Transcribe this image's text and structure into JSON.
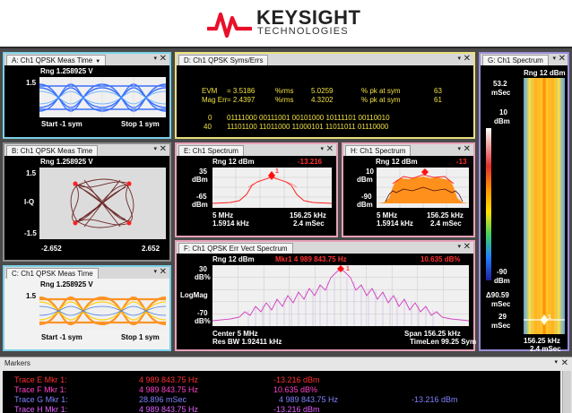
{
  "brand": {
    "name": "KEYSIGHT",
    "sub": "TECHNOLOGIES",
    "color": "#e8102b"
  },
  "windows": {
    "a": {
      "title": "A: Ch1 QPSK Meas Time",
      "rng": "Rng 1.258925  V",
      "ytop": "1.5",
      "start": "Start -1  sym",
      "stop": "Stop 1  sym"
    },
    "b": {
      "title": "B: Ch1 QPSK Meas Time",
      "rng": "Rng 1.258925  V",
      "ytop": "1.5",
      "ymid": "I-Q",
      "ybot": "-1.5",
      "xleft": "-2.652",
      "xright": "2.652"
    },
    "c": {
      "title": "C: Ch1 QPSK Meas Time",
      "rng": "Rng 1.258925  V",
      "ytop": "1.5",
      "start": "Start -1  sym",
      "stop": "Stop 1  sym"
    },
    "d": {
      "title": "D: Ch1 QPSK Syms/Errs",
      "evm_label": "EVM",
      "evm_value": "= 3.5186",
      "evm_unit": "%rms",
      "evm_pk": "5.0259",
      "evm_pk_label": "% pk  at  sym",
      "evm_sym": "63",
      "mag_label": "Mag Err",
      "mag_value": "= 2.4397",
      "mag_unit": "%rms",
      "mag_pk": "4.3202",
      "mag_pk_label": "% pk  at  sym",
      "mag_sym": "61",
      "row0_idx": "0",
      "row0_bits": "01111000  00111001  00101000  10111101  00110010",
      "row1_idx": "40",
      "row1_bits": "11101100  11011000  11000101  11011011  01110000"
    },
    "e": {
      "title": "E: Ch1 Spectrum",
      "rng": "Rng 12 dBm",
      "mkr": "-13.216",
      "ytop": "35",
      "yunit": "dBm",
      "ybot": "-65",
      "yunit2": "dBm",
      "xl": "5 MHz",
      "xr": "156.25 kHz",
      "rbw": "1.5914 kHz",
      "time": "2.4 mSec",
      "marker": "1"
    },
    "h": {
      "title": "H: Ch1 Spectrum",
      "rng": "Rng 12 dBm",
      "mkr": "-13",
      "ytop": "10",
      "yunit": "dBm",
      "ybot": "-90",
      "yunit2": "dBm",
      "xl": "5 MHz",
      "xr": "156.25 kHz",
      "rbw": "1.5914 kHz",
      "time": "2.4 mSec"
    },
    "f": {
      "title": "F: Ch1 QPSK Err Vect Spectrum",
      "rng": "Rng 12 dBm",
      "mkr": "Mkr1   4 989 843.75  Hz",
      "mkrval": "10.635  dB%",
      "ytop": "30",
      "yunit": "dB%",
      "ymid": "LogMag",
      "ybot": "-70",
      "yunit2": "dB%",
      "center": "Center 5 MHz",
      "span": "Span 156.25 kHz",
      "rbw": "Res BW 1.92411 kHz",
      "timelen": "TimeLen 99.25  Sym",
      "marker": "1"
    },
    "g": {
      "title": "G: Ch1 Spectrum",
      "rng": "Rng 12 dBm",
      "t1": "53.2",
      "t1u": "mSec",
      "v10": "10",
      "v10u": "dBm",
      "vm90": "-90",
      "vm90u": "dBm",
      "d": "Δ90.59",
      "du": "mSec",
      "t29": "29",
      "t29u": "mSec",
      "f": "156.25 kHz",
      "tm": "2.4 mSec",
      "marker": "1"
    }
  },
  "markers": {
    "title": "Markers",
    "rows": [
      {
        "trace": "Trace E  Mkr   1:",
        "f1": "4 989 843.75 Hz",
        "v1": "-13.216 dBm",
        "f2": "",
        "v2": "",
        "color": "#ff3030"
      },
      {
        "trace": "Trace F  Mkr   1:",
        "f1": "4 989 843.75 Hz",
        "v1": "10.635 dB%",
        "f2": "",
        "v2": "",
        "color": "#ff40c8"
      },
      {
        "trace": "Trace G  Mkr   1:",
        "f1": "28.896   mSec",
        "v1": "",
        "f2": "4 989 843.75 Hz",
        "v2": "-13.216 dBm",
        "color": "#8080ff"
      },
      {
        "trace": "Trace H  Mkr   1:",
        "f1": "4 989 843.75 Hz",
        "v1": "-13.216 dBm",
        "f2": "",
        "v2": "",
        "color": "#e060ff"
      }
    ]
  },
  "icons": {
    "minimize": "▾",
    "close": "✕",
    "dropdown": "▼"
  },
  "colors": {
    "accent": "#e8102b",
    "eye_blue": "#1e5cff",
    "eye_orange": "#ff8a10",
    "trace_red": "#ff2020",
    "trace_pink": "#d040c0"
  }
}
